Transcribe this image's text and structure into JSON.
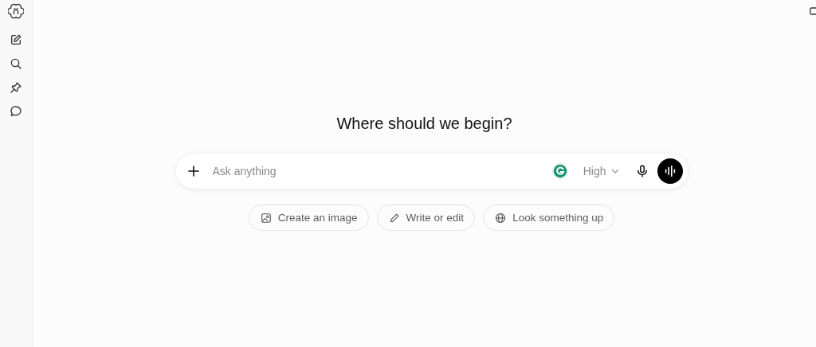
{
  "heading": "Where should we begin?",
  "composer": {
    "placeholder": "Ask anything",
    "model_level": "High"
  },
  "suggestions": [
    {
      "label": "Create an image",
      "kind": "image"
    },
    {
      "label": "Write or edit",
      "kind": "pencil"
    },
    {
      "label": "Look something up",
      "kind": "globe"
    }
  ]
}
